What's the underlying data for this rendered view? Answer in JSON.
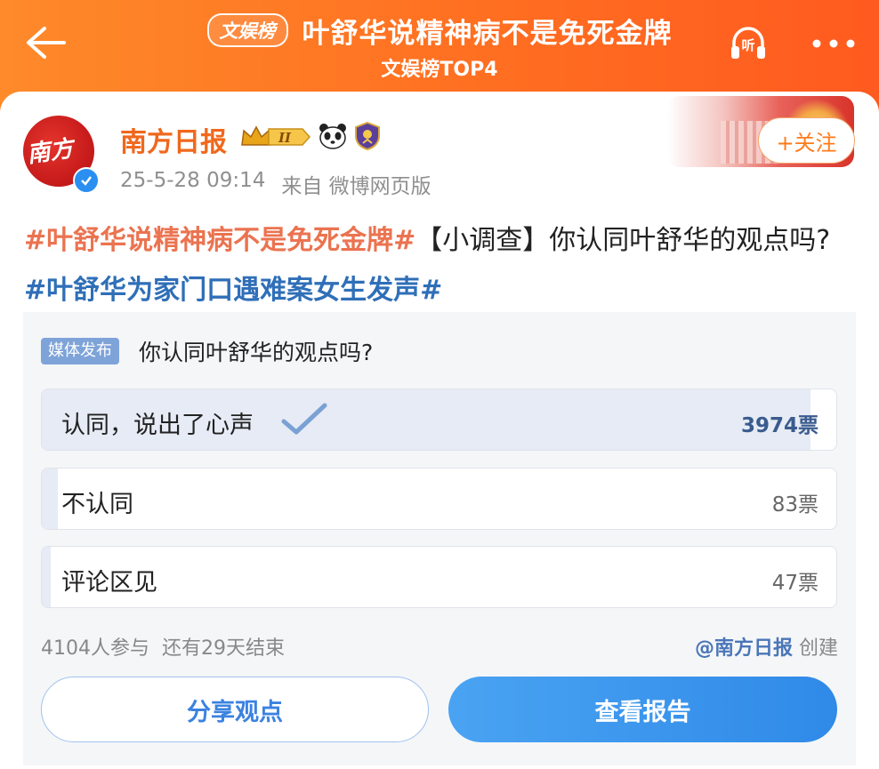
{
  "header": {
    "rank_tag": "文娱榜",
    "title": "叶舒华说精神病不是免死金牌",
    "subtitle": "文娱榜TOP4",
    "listen_label": "听"
  },
  "post": {
    "user_name": "南方日报",
    "avatar_text": "南方",
    "badge_level": "II",
    "follow_label": "+关注",
    "timestamp": "25-5-28 09:14",
    "source": "来自 微博网页版",
    "hashtag_1": "#叶舒华说精神病不是免死金牌#",
    "text_1": "【小调查】你认同叶舒华的观点吗?",
    "hashtag_2": "#叶舒华为家门口遇难案女生发声#"
  },
  "poll": {
    "tag": "媒体发布",
    "question": "你认同叶舒华的观点吗?",
    "options": [
      {
        "label": "认同，说出了心声",
        "count": "3974票",
        "share": 0.968,
        "selected": true
      },
      {
        "label": "不认同",
        "count": "83票",
        "share": 0.02,
        "selected": false
      },
      {
        "label": "评论区见",
        "count": "47票",
        "share": 0.011,
        "selected": false
      }
    ],
    "participants": "4104人参与",
    "remaining": "还有29天结束",
    "creator_name": "@南方日报",
    "creator_suffix": "创建",
    "share_button": "分享观点",
    "report_button": "查看报告"
  },
  "colors": {
    "header_orange": "#ff6f21",
    "hashtag_orange": "#eb7350",
    "hashtag_blue": "#2f6fb8",
    "button_blue": "#2f8ae8"
  }
}
